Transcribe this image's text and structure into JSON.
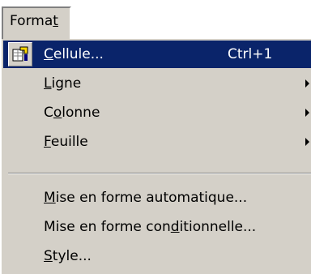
{
  "menubar": {
    "format": {
      "before": "Forma",
      "key": "t",
      "after": ""
    }
  },
  "menu": {
    "cellule": {
      "before": "",
      "key": "C",
      "after": "ellule...",
      "shortcut": "Ctrl+1",
      "icon": "format-cells-icon"
    },
    "ligne": {
      "before": "",
      "key": "L",
      "after": "igne"
    },
    "colonne": {
      "before": "C",
      "key": "o",
      "after": "lonne"
    },
    "feuille": {
      "before": "",
      "key": "F",
      "after": "euille"
    },
    "mise_auto": {
      "before": "",
      "key": "M",
      "after": "ise en forme automatique..."
    },
    "mise_cond": {
      "before": "Mise en forme con",
      "key": "d",
      "after": "itionnelle..."
    },
    "style": {
      "before": "",
      "key": "S",
      "after": "tyle..."
    }
  },
  "colors": {
    "menu_face": "#d4d0c8",
    "highlight": "#0a246a",
    "highlight_text": "#ffffff"
  }
}
